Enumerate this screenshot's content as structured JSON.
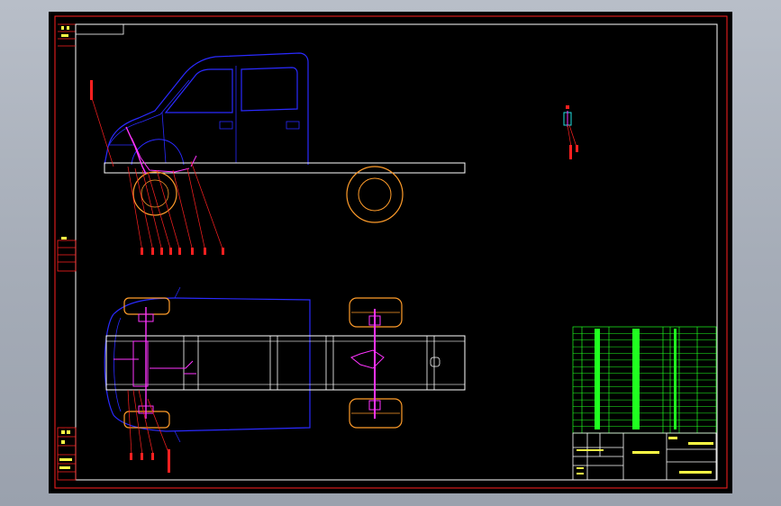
{
  "window": {
    "title": "",
    "background": "#a9b0bb",
    "canvas_color": "#000000"
  },
  "drawing": {
    "border_color": "#ff2020",
    "frame_color": "#ffffff",
    "views": [
      "side-view",
      "top-view",
      "detail-view"
    ]
  },
  "colors": {
    "body": "#2a2aff",
    "frame": "#ffffff",
    "wheel": "#ff9c2a",
    "steering": "#ff33ff",
    "leaders": "#ff2020",
    "table": "#20ff20",
    "titleblock": "#ffffff"
  },
  "parts_table": {
    "row_count": 16
  }
}
